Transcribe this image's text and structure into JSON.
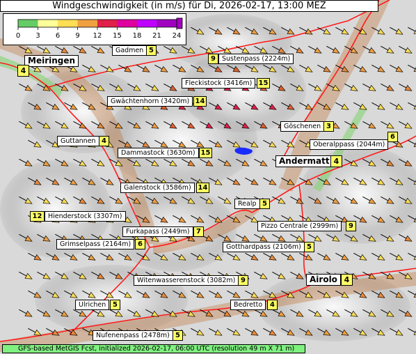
{
  "title": "Windgeschwindigkeit (in m/s) für Di, 2026-02-17, 13:00 MEZ",
  "footer": "GFS-based MetGIS Fcst, initialized 2026-02-17, 06:00 UTC  (resolution 49 m X 71 m)",
  "legend": {
    "ticks": [
      "0",
      "3",
      "6",
      "9",
      "12",
      "15",
      "18",
      "21",
      "24"
    ],
    "colors": [
      "#66cc66",
      "#ffff99",
      "#ffdd55",
      "#f0a040",
      "#e06030",
      "#e0204a",
      "#e000a0",
      "#c000ff",
      "#a000c0"
    ]
  },
  "places": [
    {
      "name": "Gadmen",
      "value": "5"
    },
    {
      "name": "Meiringen",
      "value": "4"
    },
    {
      "name": "Sustenpass (2224m)",
      "value": "9"
    },
    {
      "name": "Fleckistock (3416m)",
      "value": "15"
    },
    {
      "name": "Gwächtenhorn (3420m)",
      "value": "14"
    },
    {
      "name": "Göschenen",
      "value": "3"
    },
    {
      "name": "Guttannen",
      "value": "4"
    },
    {
      "name": "Oberalppass (2044m)",
      "value": "6"
    },
    {
      "name": "Dammastock (3630m)",
      "value": "15"
    },
    {
      "name": "Andermatt",
      "value": "4"
    },
    {
      "name": "Galenstock (3586m)",
      "value": "14"
    },
    {
      "name": "Realp",
      "value": "5"
    },
    {
      "name": "Hienderstock (3307m)",
      "value": "12"
    },
    {
      "name": "Pizzo Centrale (2999m)",
      "value": "9"
    },
    {
      "name": "Furkapass (2449m)",
      "value": "7"
    },
    {
      "name": "Grimselpass (2164m)",
      "value": "6"
    },
    {
      "name": "Gotthardpass (2106m)",
      "value": "5"
    },
    {
      "name": "Witenwasserenstock (3082m)",
      "value": "9"
    },
    {
      "name": "Airolo",
      "value": "4"
    },
    {
      "name": "Ulrichen",
      "value": "5"
    },
    {
      "name": "Bedretto",
      "value": "4"
    },
    {
      "name": "Nufenenpass (2478m)",
      "value": "5"
    }
  ]
}
